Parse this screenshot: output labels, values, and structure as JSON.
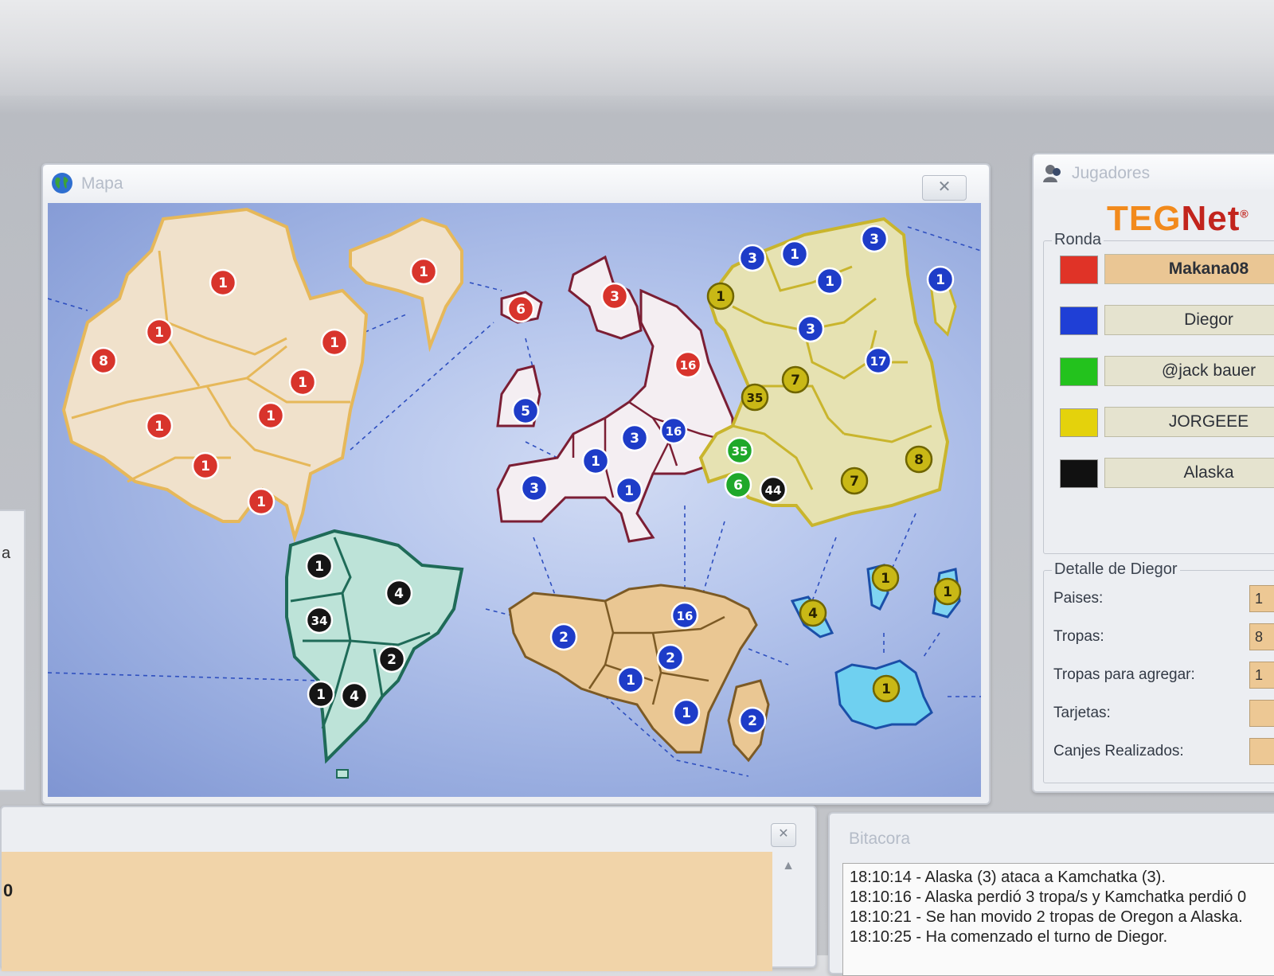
{
  "map_window": {
    "title": "Mapa",
    "close": "✕"
  },
  "players_window": {
    "title": "Jugadores",
    "logo": {
      "teg": "TEG",
      "net": "Net",
      "reg": "®"
    },
    "round_label": "Ronda",
    "players": [
      {
        "name": "Makana08",
        "color": "#e03327",
        "active": true
      },
      {
        "name": "Diegor",
        "color": "#1f3fd6",
        "active": false
      },
      {
        "name": "@jack bauer",
        "color": "#23c21d",
        "active": false
      },
      {
        "name": "JORGEEE",
        "color": "#e4d20c",
        "active": false
      },
      {
        "name": "Alaska",
        "color": "#111111",
        "active": false
      }
    ],
    "detail": {
      "label": "Detalle de Diegor",
      "fields": [
        {
          "label": "Paises:",
          "value": "1"
        },
        {
          "label": "Tropas:",
          "value": "8"
        },
        {
          "label": "Tropas para agregar:",
          "value": "1"
        },
        {
          "label": "Tarjetas:",
          "value": ""
        },
        {
          "label": "Canjes Realizados:",
          "value": ""
        }
      ]
    }
  },
  "bottom_left": {
    "close": "✕",
    "side_text": "0"
  },
  "left_panel_text": "a",
  "bitacora": {
    "title": "Bitacora",
    "lines": [
      "18:10:14 - Alaska (3) ataca a Kamchatka (3).",
      "18:10:16 - Alaska perdió 3 tropa/s y Kamchatka perdió 0",
      "18:10:21 - Se han movido 2 tropas de Oregon a Alaska.",
      "18:10:25 - Ha comenzado el turno de Diegor."
    ]
  },
  "colors": {
    "red": "#d8342c",
    "blue": "#1e3cc8",
    "green": "#1fa82a",
    "yellow": "#c9b816",
    "black": "#151515"
  },
  "map_markers": [
    {
      "v": "1",
      "c": "red"
    },
    {
      "v": "1",
      "c": "red"
    },
    {
      "v": "1",
      "c": "red"
    },
    {
      "v": "8",
      "c": "red"
    },
    {
      "v": "1",
      "c": "red"
    },
    {
      "v": "1",
      "c": "red"
    },
    {
      "v": "1",
      "c": "red"
    },
    {
      "v": "1",
      "c": "red"
    },
    {
      "v": "1",
      "c": "red"
    },
    {
      "v": "1",
      "c": "red"
    },
    {
      "v": "6",
      "c": "red"
    },
    {
      "v": "3",
      "c": "red"
    },
    {
      "v": "16",
      "c": "red"
    },
    {
      "v": "5",
      "c": "blue"
    },
    {
      "v": "3",
      "c": "blue"
    },
    {
      "v": "16",
      "c": "blue"
    },
    {
      "v": "1",
      "c": "blue"
    },
    {
      "v": "3",
      "c": "blue"
    },
    {
      "v": "1",
      "c": "blue"
    },
    {
      "v": "3",
      "c": "blue"
    },
    {
      "v": "1",
      "c": "blue"
    },
    {
      "v": "1",
      "c": "blue"
    },
    {
      "v": "3",
      "c": "blue"
    },
    {
      "v": "1",
      "c": "blue"
    },
    {
      "v": "3",
      "c": "blue"
    },
    {
      "v": "17",
      "c": "blue"
    },
    {
      "v": "1",
      "c": "yellow"
    },
    {
      "v": "7",
      "c": "yellow"
    },
    {
      "v": "35",
      "c": "yellow"
    },
    {
      "v": "35",
      "c": "green"
    },
    {
      "v": "6",
      "c": "green"
    },
    {
      "v": "44",
      "c": "black"
    },
    {
      "v": "7",
      "c": "yellow"
    },
    {
      "v": "8",
      "c": "yellow"
    },
    {
      "v": "1",
      "c": "black"
    },
    {
      "v": "4",
      "c": "black"
    },
    {
      "v": "34",
      "c": "black"
    },
    {
      "v": "2",
      "c": "black"
    },
    {
      "v": "1",
      "c": "black"
    },
    {
      "v": "4",
      "c": "black"
    },
    {
      "v": "2",
      "c": "blue"
    },
    {
      "v": "16",
      "c": "blue"
    },
    {
      "v": "2",
      "c": "blue"
    },
    {
      "v": "1",
      "c": "blue"
    },
    {
      "v": "1",
      "c": "blue"
    },
    {
      "v": "2",
      "c": "blue"
    },
    {
      "v": "4",
      "c": "yellow"
    },
    {
      "v": "1",
      "c": "yellow"
    },
    {
      "v": "1",
      "c": "yellow"
    },
    {
      "v": "1",
      "c": "yellow"
    }
  ]
}
